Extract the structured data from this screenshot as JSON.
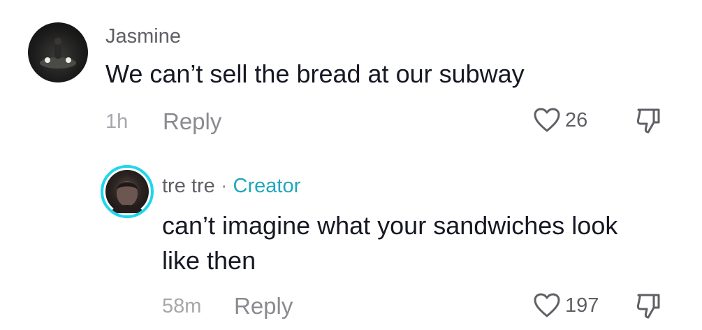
{
  "comments": [
    {
      "username": "Jasmine",
      "text": "We can’t sell the bread at our subway",
      "time": "1h",
      "reply_label": "Reply",
      "likes": "26"
    }
  ],
  "reply": {
    "username": "tre tre",
    "separator": "·",
    "badge": "Creator",
    "text_line1": "can’t imagine what your sandwiches look",
    "text_line2": "like then",
    "time": "58m",
    "reply_label": "Reply",
    "likes": "197"
  },
  "icons": {
    "like": "heart-outline-icon",
    "dislike": "thumbs-down-outline-icon"
  },
  "colors": {
    "creator_accent": "#20a6bd",
    "avatar_ring": "#20d5ec"
  }
}
